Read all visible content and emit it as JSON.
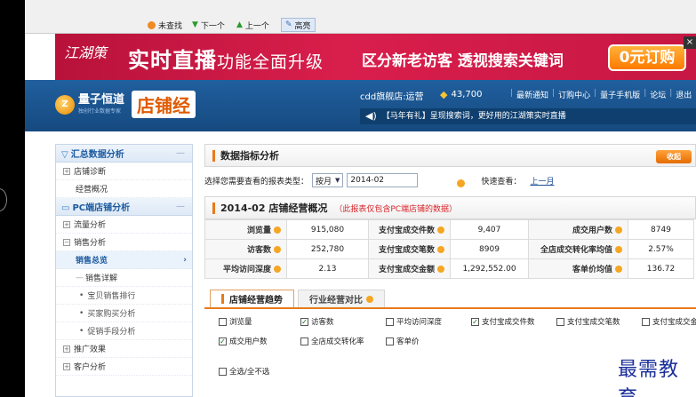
{
  "findbar": {
    "items": [
      "未查找",
      "下一个",
      "上一个",
      "高亮"
    ]
  },
  "banner": {
    "logo": "江湖策",
    "headline": "实时直播",
    "headline_sub": "功能全面升级",
    "promo": "区分新老访客  透视搜索关键词",
    "cta": "0元订购",
    "close": "×"
  },
  "header": {
    "brand_name": "量子恒道",
    "brand_tag": "独创行业数据专家",
    "product": "店铺经",
    "shop": "cdd旗舰店:运营",
    "coins": "43,700",
    "nav": [
      "最新通知",
      "订购中心",
      "量子手机版",
      "论坛",
      "退出"
    ],
    "ticker": "【马年有礼】呈现搜索词，更好用的江湖策实时直播"
  },
  "sidebar": {
    "groups": [
      {
        "label": "汇总数据分析",
        "items": [
          "店铺诊断",
          "经营概况"
        ]
      },
      {
        "label": "PC端店铺分析",
        "items": [
          "流量分析",
          "销售分析",
          "销售总览",
          "销售详解",
          "宝贝销售排行",
          "买家购买分析",
          "促销手段分析",
          "推广效果",
          "客户分析"
        ]
      }
    ]
  },
  "main": {
    "section_title": "数据指标分析",
    "collapse": "收起",
    "filter_label": "选择您需要查看的报表类型：",
    "period_type": "按月",
    "period_value": "2014-02",
    "quick_label": "快速查看：",
    "quick_link": "上一月",
    "overview_title": "2014-02 店铺经营概况",
    "overview_note": "（此报表仅包含PC端店铺的数据）",
    "metrics": [
      [
        {
          "l": "浏览量",
          "v": "915,080"
        },
        {
          "l": "支付宝成交件数",
          "v": "9,407"
        },
        {
          "l": "成交用户数",
          "v": "8749"
        }
      ],
      [
        {
          "l": "访客数",
          "v": "252,780"
        },
        {
          "l": "支付宝成交笔数",
          "v": "8909"
        },
        {
          "l": "全店成交转化率均值",
          "v": "2.57%"
        }
      ],
      [
        {
          "l": "平均访问深度",
          "v": "2.13"
        },
        {
          "l": "支付宝成交金额",
          "v": "1,292,552.00"
        },
        {
          "l": "客单价均值",
          "v": "136.72"
        }
      ]
    ],
    "tabs": [
      "店铺经营趋势",
      "行业经营对比"
    ],
    "checks": [
      {
        "label": "浏览量",
        "checked": false
      },
      {
        "label": "访客数",
        "checked": true
      },
      {
        "label": "平均访问深度",
        "checked": false
      },
      {
        "label": "支付宝成交件数",
        "checked": true
      },
      {
        "label": "支付宝成交笔数",
        "checked": false
      },
      {
        "label": "支付宝成交金额",
        "checked": false
      },
      {
        "label": "成交用户数",
        "checked": true
      },
      {
        "label": "全店成交转化率",
        "checked": false
      },
      {
        "label": "客单价",
        "checked": false
      }
    ],
    "select_all": "全选/全不选"
  },
  "watermark": "最需教育"
}
